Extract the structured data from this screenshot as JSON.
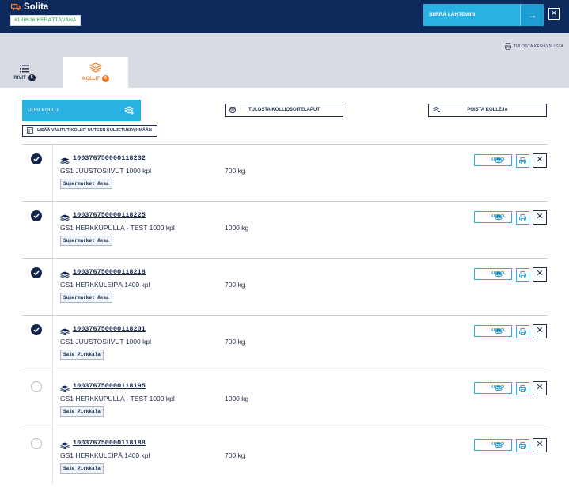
{
  "header": {
    "brand": "Solita",
    "order_chip": "#138626  KERÄTTÄVÄNÄ",
    "send_label": "SIIRRÄ LÄHTEVIIN",
    "colors": {
      "navy": "#0e2a5c",
      "accent": "#2ab1e3",
      "orange": "#ee7b2a",
      "green": "#2e9c61"
    }
  },
  "toolbar": {
    "print_list": "TULOSTA KERÄYSLISTA"
  },
  "tabs": [
    {
      "label": "RIVIT",
      "count": "8",
      "icon": "list-icon",
      "active": false
    },
    {
      "label": "KOLLIT",
      "count": "6",
      "icon": "package-icon",
      "active": true
    }
  ],
  "actions": {
    "new_kollu": "UUSI KOLLU",
    "print_labels": "TULOSTA KOLLIOSOITELAPUT",
    "delete": "POISTA KOLLEJA",
    "add_to_group": "LISÄÄ VALITUT KOLLIT UUTEEN KULJETUSRYHMÄÄN"
  },
  "row_actions": {
    "copy": "KOPIOI"
  },
  "rows": [
    {
      "checked": true,
      "code": "100376750000118232",
      "desc": "GS1 JUUSTOSIIVUT 1000 kpl",
      "weight": "700 kg",
      "tag": "Supermarket Akaa"
    },
    {
      "checked": true,
      "code": "100376750000118225",
      "desc": "GS1 HERKKUPULLA - TEST 1000 kpl",
      "weight": "1000 kg",
      "tag": "Supermarket Akaa"
    },
    {
      "checked": true,
      "code": "100376750000118218",
      "desc": "GS1 HERKKULEIPÄ 1400 kpl",
      "weight": "700 kg",
      "tag": "Supermarket Akaa"
    },
    {
      "checked": true,
      "code": "100376750000118201",
      "desc": "GS1 JUUSTOSIIVUT 1000 kpl",
      "weight": "700 kg",
      "tag": "Sale Pirkkala"
    },
    {
      "checked": false,
      "code": "100376750000118195",
      "desc": "GS1 HERKKUPULLA - TEST 1000 kpl",
      "weight": "1000 kg",
      "tag": "Sale Pirkkala"
    },
    {
      "checked": false,
      "code": "100376750000118188",
      "desc": "GS1 HERKKULEIPÄ 1400 kpl",
      "weight": "700 kg",
      "tag": "Sale Pirkkala"
    }
  ]
}
